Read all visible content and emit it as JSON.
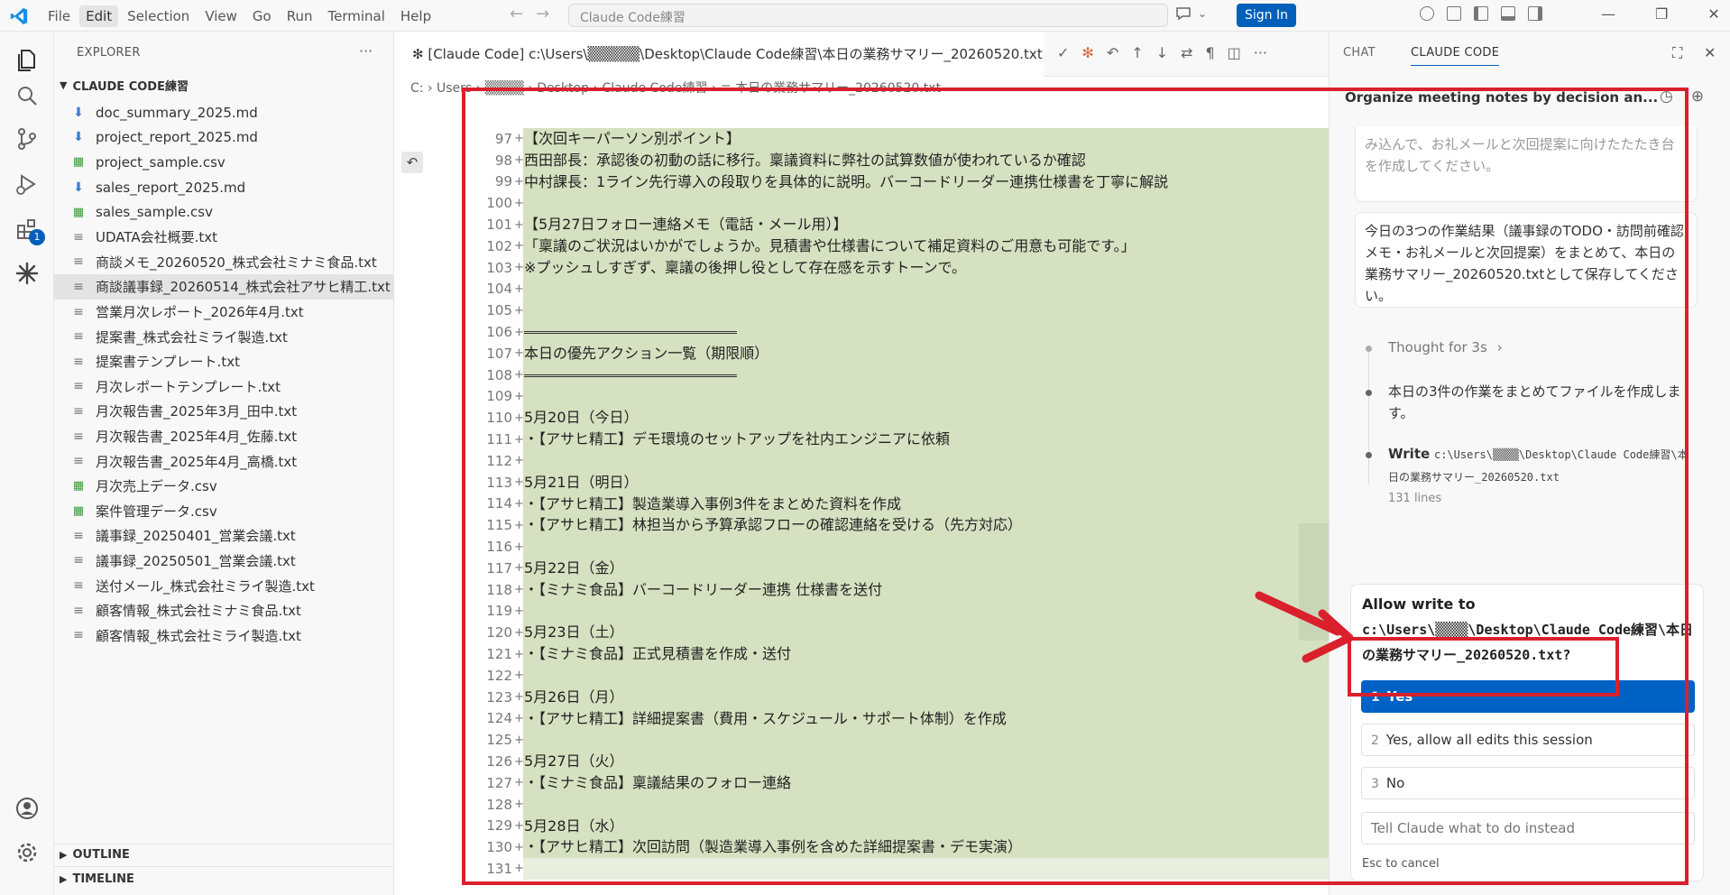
{
  "menu": {
    "items": [
      "File",
      "Edit",
      "Selection",
      "View",
      "Go",
      "Run",
      "Terminal",
      "Help"
    ],
    "active_index": 1
  },
  "search": {
    "text": "Claude Code練習"
  },
  "signin_label": "Sign In",
  "explorer": {
    "title": "EXPLORER",
    "folder": "CLAUDE CODE練習",
    "files": [
      {
        "name": "doc_summary_2025.md",
        "type": "md"
      },
      {
        "name": "project_report_2025.md",
        "type": "md"
      },
      {
        "name": "project_sample.csv",
        "type": "csv"
      },
      {
        "name": "sales_report_2025.md",
        "type": "md"
      },
      {
        "name": "sales_sample.csv",
        "type": "csv"
      },
      {
        "name": "UDATA会社概要.txt",
        "type": "txt"
      },
      {
        "name": "商談メモ_20260520_株式会社ミナミ食品.txt",
        "type": "txt"
      },
      {
        "name": "商談議事録_20260514_株式会社アサヒ精工.txt",
        "type": "txt",
        "selected": true
      },
      {
        "name": "営業月次レポート_2026年4月.txt",
        "type": "txt"
      },
      {
        "name": "提案書_株式会社ミライ製造.txt",
        "type": "txt"
      },
      {
        "name": "提案書テンプレート.txt",
        "type": "txt"
      },
      {
        "name": "月次レポートテンプレート.txt",
        "type": "txt"
      },
      {
        "name": "月次報告書_2025年3月_田中.txt",
        "type": "txt"
      },
      {
        "name": "月次報告書_2025年4月_佐藤.txt",
        "type": "txt"
      },
      {
        "name": "月次報告書_2025年4月_高橋.txt",
        "type": "txt"
      },
      {
        "name": "月次売上データ.csv",
        "type": "csv"
      },
      {
        "name": "案件管理データ.csv",
        "type": "csv"
      },
      {
        "name": "議事録_20250401_営業会議.txt",
        "type": "txt"
      },
      {
        "name": "議事録_20250501_営業会議.txt",
        "type": "txt"
      },
      {
        "name": "送付メール_株式会社ミライ製造.txt",
        "type": "txt"
      },
      {
        "name": "顧客情報_株式会社ミナミ食品.txt",
        "type": "txt"
      },
      {
        "name": "顧客情報_株式会社ミライ製造.txt",
        "type": "txt"
      }
    ],
    "outline": "OUTLINE",
    "timeline": "TIMELINE"
  },
  "editor": {
    "tab_title": "✻ [Claude Code] c:\\Users\\▒▒▒▒▒\\Desktop\\Claude Code練習\\本日の業務サマリー_20260520.txt",
    "breadcrumb": "C: › Users › ▒▒▒▒ › Desktop › Claude Code練習 › ≡ 本日の業務サマリー_20260520.txt",
    "lines": [
      {
        "n": "97",
        "t": "【次回キーパーソン別ポイント】"
      },
      {
        "n": "98",
        "t": "西田部長：承認後の初動の話に移行。稟議資料に弊社の試算数値が使われているか確認"
      },
      {
        "n": "99",
        "t": "中村課長：1ライン先行導入の段取りを具体的に説明。バーコードリーダー連携仕様書を丁寧に解説"
      },
      {
        "n": "100",
        "t": ""
      },
      {
        "n": "101",
        "t": "【5月27日フォロー連絡メモ（電話・メール用）】"
      },
      {
        "n": "102",
        "t": "「稟議のご状況はいかがでしょうか。見積書や仕様書について補足資料のご用意も可能です。」"
      },
      {
        "n": "103",
        "t": "※プッシュしすぎず、稟議の後押し役として存在感を示すトーンで。"
      },
      {
        "n": "104",
        "t": ""
      },
      {
        "n": "105",
        "t": ""
      },
      {
        "n": "106",
        "t": "",
        "sep": true
      },
      {
        "n": "107",
        "t": "本日の優先アクション一覧（期限順）"
      },
      {
        "n": "108",
        "t": "",
        "sep": true
      },
      {
        "n": "109",
        "t": ""
      },
      {
        "n": "110",
        "t": "5月20日（今日）"
      },
      {
        "n": "111",
        "t": "・【アサヒ精工】デモ環境のセットアップを社内エンジニアに依頼"
      },
      {
        "n": "112",
        "t": ""
      },
      {
        "n": "113",
        "t": "5月21日（明日）"
      },
      {
        "n": "114",
        "t": "・【アサヒ精工】製造業導入事例3件をまとめた資料を作成"
      },
      {
        "n": "115",
        "t": "・【アサヒ精工】林担当から予算承認フローの確認連絡を受ける（先方対応）"
      },
      {
        "n": "116",
        "t": ""
      },
      {
        "n": "117",
        "t": "5月22日（金）"
      },
      {
        "n": "118",
        "t": "・【ミナミ食品】バーコードリーダー連携 仕様書を送付"
      },
      {
        "n": "119",
        "t": ""
      },
      {
        "n": "120",
        "t": "5月23日（土）"
      },
      {
        "n": "121",
        "t": "・【ミナミ食品】正式見積書を作成・送付"
      },
      {
        "n": "122",
        "t": ""
      },
      {
        "n": "123",
        "t": "5月26日（月）"
      },
      {
        "n": "124",
        "t": "・【アサヒ精工】詳細提案書（費用・スケジュール・サポート体制）を作成"
      },
      {
        "n": "125",
        "t": ""
      },
      {
        "n": "126",
        "t": "5月27日（火）"
      },
      {
        "n": "127",
        "t": "・【ミナミ食品】稟議結果のフォロー連絡"
      },
      {
        "n": "128",
        "t": ""
      },
      {
        "n": "129",
        "t": "5月28日（水）"
      },
      {
        "n": "130",
        "t": "・【アサヒ精工】次回訪問（製造業導入事例を含めた詳細提案書・デモ実演）"
      },
      {
        "n": "131",
        "t": "",
        "last": true
      }
    ]
  },
  "panel": {
    "tab_chat": "CHAT",
    "tab_claude": "CLAUDE CODE",
    "session_title": "Organize meeting notes by decision an...",
    "prev_message": "み込んで、お礼メールと次回提案に向けたたたき台を作成してください。",
    "user_message": "今日の3つの作業結果（議事録のTODO・訪問前確認メモ・お礼メールと次回提案）をまとめて、本日の業務サマリー_20260520.txtとして保存してください。",
    "thought": "Thought for 3s",
    "assistant_text": "本日の3件の作業をまとめてファイルを作成します。",
    "write_label": "Write",
    "write_path": "c:\\Users\\▒▒▒▒\\Desktop\\Claude Code練習\\本日の業務サマリー_20260520.txt",
    "write_lines": "131 lines",
    "permission": {
      "title": "Allow write to",
      "path": "c:\\Users\\▒▒▒▒\\Desktop\\Claude Code練習\\本日の業務サマリー_20260520.txt?",
      "options": [
        {
          "num": "1",
          "label": "Yes"
        },
        {
          "num": "2",
          "label": "Yes, allow all edits this session"
        },
        {
          "num": "3",
          "label": "No"
        }
      ],
      "input_placeholder": "Tell Claude what to do instead",
      "esc_hint": "Esc to cancel"
    }
  },
  "colors": {
    "accent": "#005fb8",
    "diff_added": "#d5e1c0",
    "annotation": "#d9202c"
  }
}
